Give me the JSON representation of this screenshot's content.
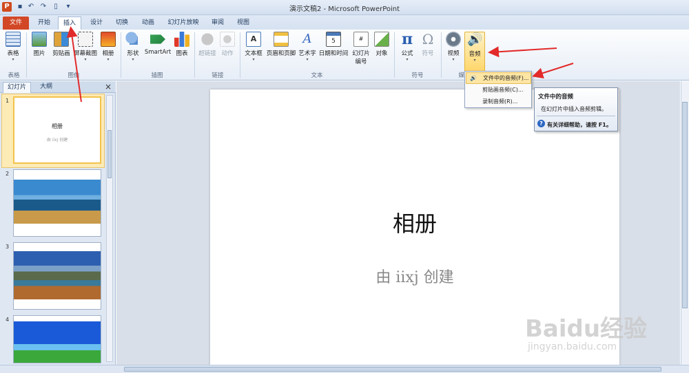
{
  "titlebar": {
    "app_icon": "P",
    "title": "演示文稿2 - Microsoft PowerPoint",
    "qat": [
      "save-icon",
      "undo-icon",
      "redo-icon",
      "new-icon",
      "customize-icon"
    ]
  },
  "tabs": [
    {
      "label": "文件"
    },
    {
      "label": "开始"
    },
    {
      "label": "插入"
    },
    {
      "label": "设计"
    },
    {
      "label": "切换"
    },
    {
      "label": "动画"
    },
    {
      "label": "幻灯片放映"
    },
    {
      "label": "审阅"
    },
    {
      "label": "视图"
    }
  ],
  "ribbon": {
    "buttons": {
      "table": "表格",
      "picture": "图片",
      "clipart": "剪贴画",
      "screenshot": "屏幕截图",
      "album": "相册",
      "shapes": "形状",
      "smartart": "SmartArt",
      "chart": "图表",
      "hyperlink": "超链接",
      "action": "动作",
      "textbox": "文本框",
      "header_footer": "页眉和页脚",
      "wordart": "艺术字",
      "datetime": "日期和时间",
      "slide_number_1": "幻灯片",
      "slide_number_2": "编号",
      "object": "对象",
      "equation": "公式",
      "symbol": "符号",
      "video": "视频",
      "audio": "音频"
    },
    "groups": {
      "tables": "表格",
      "images": "图像",
      "illustrations": "插图",
      "links": "链接",
      "text": "文本",
      "symbols": "符号",
      "media": "媒"
    }
  },
  "audio_menu": {
    "items": [
      {
        "label": "文件中的音频(F)..."
      },
      {
        "label": "剪贴画音频(C)..."
      },
      {
        "label": "录制音频(R)..."
      }
    ]
  },
  "tooltip": {
    "title": "文件中的音频",
    "description": "在幻灯片中插入音频剪辑。",
    "help": "有关详细帮助，请按 F1。"
  },
  "left_pane": {
    "tabs": [
      {
        "label": "幻灯片"
      },
      {
        "label": "大纲"
      }
    ],
    "slides": [
      {
        "number": "1",
        "title": "相册",
        "subtitle": "由 iixj 创建"
      },
      {
        "number": "2"
      },
      {
        "number": "3"
      },
      {
        "number": "4"
      }
    ]
  },
  "slide": {
    "title": "相册",
    "subtitle": "由 iixj 创建"
  },
  "watermark": {
    "brand": "Baidu经验",
    "url": "jingyan.baidu.com"
  }
}
